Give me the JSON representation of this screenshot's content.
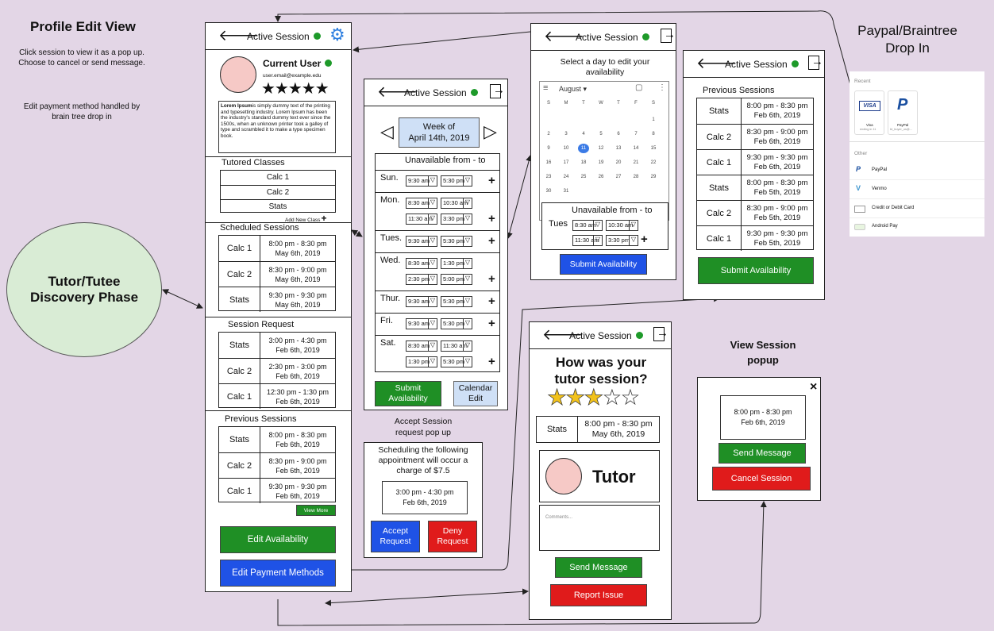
{
  "notes": {
    "title": "Profile Edit View",
    "text1": "Click session to view it as a pop up. Choose to cancel or send message.",
    "text2": "Edit payment method handled by brain tree drop in"
  },
  "discovery": {
    "label": "Tutor/Tutee Discovery Phase"
  },
  "header": {
    "active": "Active Session",
    "back": "🡐"
  },
  "profile": {
    "name": "Current User",
    "email": "user.email@example.edu",
    "stars": "★★★★★",
    "bio_bold": "Lorem Ipsum",
    "bio": "is simply dummy text of the printing and typesetting industry. Lorem Ipsum has been the industry's standard dummy text ever since the 1500s, when an unknown printer took a galley of type and scrambled it to make a type specimen book.",
    "tutored_title": "Tutored Classes",
    "classes": [
      "Calc 1",
      "Calc 2",
      "Stats"
    ],
    "add_class": "Add New Class",
    "scheduled_title": "Scheduled Sessions",
    "scheduled": [
      {
        "cls": "Calc 1",
        "time": "8:00 pm - 8:30 pm",
        "date": "May 6th, 2019"
      },
      {
        "cls": "Calc 2",
        "time": "8:30 pm - 9:00 pm",
        "date": "May 6th, 2019"
      },
      {
        "cls": "Stats",
        "time": "9:30 pm - 9:30 pm",
        "date": "May 6th, 2019"
      }
    ],
    "request_title": "Session Request",
    "requests": [
      {
        "cls": "Stats",
        "time": "3:00 pm - 4:30 pm",
        "date": "Feb 6th, 2019"
      },
      {
        "cls": "Calc 2",
        "time": "2:30 pm - 3:00 pm",
        "date": "Feb 6th, 2019"
      },
      {
        "cls": "Calc 1",
        "time": "12:30 pm - 1:30 pm",
        "date": "Feb 6th, 2019"
      }
    ],
    "previous_title": "Previous Sessions",
    "previous": [
      {
        "cls": "Stats",
        "time": "8:00 pm - 8:30 pm",
        "date": "Feb 6th, 2019"
      },
      {
        "cls": "Calc 2",
        "time": "8:30 pm - 9:00 pm",
        "date": "Feb 6th, 2019"
      },
      {
        "cls": "Calc 1",
        "time": "9:30 pm - 9:30 pm",
        "date": "Feb 6th, 2019"
      }
    ],
    "view_more": "View More",
    "edit_availability": "Edit Availability",
    "edit_payment": "Edit Payment Methods"
  },
  "availability": {
    "week_line1": "Week of",
    "week_line2": "April 14th, 2019",
    "unavailable": "Unavailable from - to",
    "days": [
      {
        "day": "Sun.",
        "slots": [
          [
            "9:30 am",
            "5:30 pm"
          ]
        ]
      },
      {
        "day": "Mon.",
        "slots": [
          [
            "8:30 am",
            "10:30 am"
          ],
          [
            "11:30 am",
            "3:30 pm"
          ]
        ]
      },
      {
        "day": "Tues.",
        "slots": [
          [
            "9:30 am",
            "5:30 pm"
          ]
        ]
      },
      {
        "day": "Wed.",
        "slots": [
          [
            "8:30 am",
            "1:30 pm"
          ],
          [
            "2:30 pm",
            "5:00 pm"
          ]
        ]
      },
      {
        "day": "Thur.",
        "slots": [
          [
            "9:30 am",
            "5:30 pm"
          ]
        ]
      },
      {
        "day": "Fri.",
        "slots": [
          [
            "9:30 am",
            "5:30 pm"
          ]
        ]
      },
      {
        "day": "Sat.",
        "slots": [
          [
            "8:30 am",
            "11:30 am"
          ],
          [
            "1:30 pm",
            "5:30 pm"
          ]
        ]
      }
    ],
    "submit": "Submit Availability",
    "calendar_edit": "Calendar Edit"
  },
  "accept": {
    "title": "Accept Session request pop up",
    "text": "Scheduling the following appointment will occur a charge of $7.5",
    "time": "3:00 pm - 4:30 pm",
    "date": "Feb 6th, 2019",
    "accept": "Accept Request",
    "deny": "Deny Request"
  },
  "calendar": {
    "prompt": "Select a day to edit your availability",
    "month": "August",
    "weekdays": [
      "S",
      "M",
      "T",
      "W",
      "T",
      "F",
      "S"
    ],
    "days": [
      "",
      "",
      "",
      "",
      "",
      "",
      "1",
      "2",
      "3",
      "4",
      "5",
      "6",
      "7",
      "8",
      "9",
      "10",
      "11",
      "12",
      "13",
      "14",
      "15",
      "16",
      "17",
      "18",
      "19",
      "20",
      "21",
      "22",
      "23",
      "24",
      "25",
      "26",
      "27",
      "28",
      "29",
      "30",
      "31"
    ],
    "selected": "11",
    "unavailable": "Unavailable from - to",
    "day": "Tues",
    "slots": [
      [
        "8:30 am",
        "10:30 am"
      ],
      [
        "11:30 am",
        "3:30 pm"
      ]
    ],
    "submit": "Submit Availability"
  },
  "previous_sessions": {
    "title": "Previous Sessions",
    "rows": [
      {
        "cls": "Stats",
        "time": "8:00 pm - 8:30 pm",
        "date": "Feb 6th, 2019"
      },
      {
        "cls": "Calc 2",
        "time": "8:30 pm - 9:00 pm",
        "date": "Feb 6th, 2019"
      },
      {
        "cls": "Calc 1",
        "time": "9:30 pm - 9:30 pm",
        "date": "Feb 6th, 2019"
      },
      {
        "cls": "Stats",
        "time": "8:00 pm - 8:30 pm",
        "date": "Feb 5th, 2019"
      },
      {
        "cls": "Calc 2",
        "time": "8:30 pm - 9:00 pm",
        "date": "Feb 5th, 2019"
      },
      {
        "cls": "Calc 1",
        "time": "9:30 pm - 9:30 pm",
        "date": "Feb 5th, 2019"
      }
    ],
    "submit": "Submit Availability"
  },
  "paypal": {
    "title": "Paypal/Braintree Drop In",
    "recent": "Recent",
    "visa": "VISA",
    "visa_label": "Visa",
    "visa_sub": "ending in 11",
    "pp_label": "PayPal",
    "pp_sub": "bt_buyer_us@...",
    "other": "Other",
    "options": [
      "PayPal",
      "Venmo",
      "Credit or Debit Card",
      "Android Pay"
    ]
  },
  "rating": {
    "question": "How was your tutor session?",
    "stars_filled": "★★★",
    "stars_empty": "☆☆",
    "cls": "Stats",
    "time": "8:00 pm - 8:30 pm",
    "date": "May 6th, 2019",
    "tutor": "Tutor",
    "comments": "Comments...",
    "send": "Send Message",
    "report": "Report Issue"
  },
  "view_popup": {
    "title": "View Session popup",
    "close": "×",
    "time": "8:00 pm - 8:30 pm",
    "date": "Feb 6th, 2019",
    "send": "Send Message",
    "cancel": "Cancel Session"
  }
}
